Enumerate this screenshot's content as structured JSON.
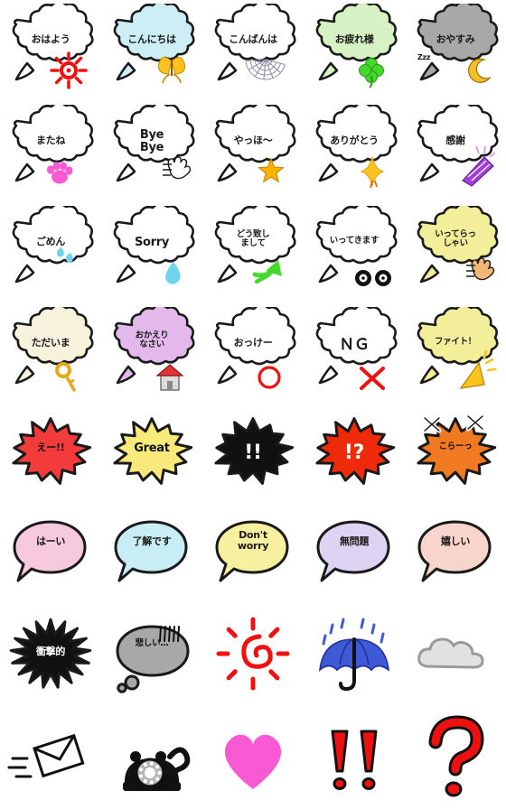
{
  "page": {
    "title": "Emoji sticker sheet",
    "background": "#ffffff",
    "columns": 5,
    "rows": 8
  },
  "palette": {
    "outline": "#1a1a1a",
    "white": "#ffffff",
    "lightblue": "#cdeef5",
    "lightgreen": "#d6f2c4",
    "gray": "#a8a8a8",
    "yellow": "#f2ee9a",
    "cream": "#f7f2dc",
    "lavender": "#e3b9ec",
    "pink": "#f7c9dc",
    "skyblue": "#c8edf5",
    "softyellow": "#f7f0a0",
    "softlavender": "#ded3f2",
    "peach": "#f7d5cc",
    "red": "#f43b3b",
    "orange": "#ef5a17",
    "black": "#111111",
    "brightred": "#ee1111",
    "hotpink": "#f95ad4",
    "gold": "#ffc21f",
    "green": "#45d92b",
    "blue": "#3f5ad6",
    "cloudgray": "#e2e2e2"
  },
  "stickers": [
    {
      "id": "ohayou",
      "row": 1,
      "col": 1,
      "text": "おはよう",
      "script": "jp",
      "shape": "cloud-bubble",
      "fill": "#ffffff",
      "decoration": "sun-icon",
      "decoration_color": "#f01010"
    },
    {
      "id": "konnichiwa",
      "row": 1,
      "col": 2,
      "text": "こんにちは",
      "script": "jp",
      "shape": "cloud-bubble",
      "fill": "#cdeef5",
      "decoration": "butterfly-icon",
      "decoration_color": "#ffc21f"
    },
    {
      "id": "konbanwa",
      "row": 1,
      "col": 3,
      "text": "こんばんは",
      "script": "jp",
      "shape": "cloud-bubble",
      "fill": "#ffffff",
      "decoration": "spiderweb-icon",
      "decoration_color": "#8f8fa8"
    },
    {
      "id": "otsukaresama",
      "row": 1,
      "col": 4,
      "text": "お疲れ様",
      "script": "jp",
      "shape": "cloud-bubble",
      "fill": "#d6f2c4",
      "decoration": "clover-icon",
      "decoration_color": "#45d92b"
    },
    {
      "id": "oyasumi",
      "row": 1,
      "col": 5,
      "text": "おやすみ",
      "script": "jp",
      "shape": "cloud-bubble",
      "fill": "#a8a8a8",
      "decoration": "moon-icon",
      "decoration_color": "#f5bd27",
      "sub_text": "Zzz"
    },
    {
      "id": "matane",
      "row": 2,
      "col": 1,
      "text": "またね",
      "script": "jp",
      "shape": "cloud-bubble",
      "fill": "#ffffff",
      "decoration": "pawprint-icon",
      "decoration_color": "#f95ad4"
    },
    {
      "id": "byebye",
      "row": 2,
      "col": 2,
      "text": "Bye\nBye",
      "script": "en",
      "shape": "cloud-bubble",
      "fill": "#ffffff",
      "decoration": "waving-hand-icon",
      "decoration_color": "#1a1a1a"
    },
    {
      "id": "yahho",
      "row": 2,
      "col": 3,
      "text": "やっほ〜",
      "script": "jp",
      "shape": "cloud-bubble",
      "fill": "#ffffff",
      "decoration": "star-icon",
      "decoration_color": "#ffb500"
    },
    {
      "id": "arigatou",
      "row": 2,
      "col": 4,
      "text": "ありがとう",
      "script": "jp",
      "shape": "cloud-bubble",
      "fill": "#ffffff",
      "decoration": "sparkle-icon",
      "decoration_color": "#ffc21f"
    },
    {
      "id": "kansha",
      "row": 2,
      "col": 5,
      "text": "感謝",
      "script": "jp",
      "shape": "cloud-bubble",
      "fill": "#ffffff",
      "decoration": "folding-fan-icon",
      "decoration_color": "#a23fd6"
    },
    {
      "id": "gomen",
      "row": 3,
      "col": 1,
      "text": "ごめん",
      "script": "jp",
      "shape": "cloud-bubble",
      "fill": "#ffffff",
      "decoration": "sweat-drops-icon",
      "decoration_color": "#6fd3ef"
    },
    {
      "id": "sorry",
      "row": 3,
      "col": 2,
      "text": "Sorry",
      "script": "en",
      "shape": "cloud-bubble",
      "fill": "#ffffff",
      "decoration": "teardrop-icon",
      "decoration_color": "#6fd3ef"
    },
    {
      "id": "douitashimashite",
      "row": 3,
      "col": 3,
      "text": "どう致し\nまして",
      "script": "jp-sm",
      "shape": "cloud-bubble",
      "fill": "#ffffff",
      "decoration": "arrow-icon",
      "decoration_color": "#45d92b"
    },
    {
      "id": "ittekimasu",
      "row": 3,
      "col": 4,
      "text": "いってきます",
      "script": "jp-sm",
      "shape": "cloud-bubble",
      "fill": "#ffffff",
      "decoration": "car-wheels-icon",
      "decoration_color": "#111111"
    },
    {
      "id": "itterasshai",
      "row": 3,
      "col": 5,
      "text": "いってらっ\nしゃい",
      "script": "jp-sm",
      "shape": "cloud-bubble",
      "fill": "#f2ee9a",
      "decoration": "waving-hand-icon",
      "decoration_color": "#f2b777"
    },
    {
      "id": "tadaima",
      "row": 4,
      "col": 1,
      "text": "ただいま",
      "script": "jp",
      "shape": "cloud-bubble",
      "fill": "#f7f2dc",
      "decoration": "key-icon",
      "decoration_color": "#e8a81c"
    },
    {
      "id": "okaerinasai",
      "row": 4,
      "col": 2,
      "text": "おかえり\nなさい",
      "script": "jp-sm",
      "shape": "cloud-bubble",
      "fill": "#e3b9ec",
      "decoration": "house-icon",
      "decoration_color": "#e03434"
    },
    {
      "id": "okke",
      "row": 4,
      "col": 3,
      "text": "おっけー",
      "script": "jp",
      "shape": "cloud-bubble",
      "fill": "#ffffff",
      "decoration": "circle-mark-icon",
      "decoration_color": "#ee1111"
    },
    {
      "id": "ng",
      "row": 4,
      "col": 4,
      "text": "ＮＧ",
      "script": "big",
      "shape": "cloud-bubble",
      "fill": "#ffffff",
      "decoration": "cross-mark-icon",
      "decoration_color": "#ee1111"
    },
    {
      "id": "fight",
      "row": 4,
      "col": 5,
      "text": "ファイト！",
      "script": "jp-sm",
      "shape": "cloud-bubble",
      "fill": "#f2ee9a",
      "decoration": "megaphone-icon",
      "decoration_color": "#ffc21f"
    },
    {
      "id": "ee",
      "row": 5,
      "col": 1,
      "text": "えー!!",
      "script": "jp",
      "shape": "burst",
      "fill": "#f43b3b",
      "text_color": "#111111",
      "decoration": "none",
      "decoration_color": ""
    },
    {
      "id": "great",
      "row": 5,
      "col": 2,
      "text": "Great",
      "script": "en",
      "shape": "burst",
      "fill": "#f7ea7a",
      "text_color": "#111111",
      "decoration": "none",
      "decoration_color": ""
    },
    {
      "id": "double-bang",
      "row": 5,
      "col": 3,
      "text": "!!",
      "script": "bang",
      "shape": "burst",
      "fill": "#111111",
      "text_color": "#ffffff",
      "decoration": "none",
      "decoration_color": ""
    },
    {
      "id": "interrobang",
      "row": 5,
      "col": 4,
      "text": "!?",
      "script": "bang",
      "shape": "burst",
      "fill": "#ef2a0a",
      "text_color": "#ffffff",
      "decoration": "none",
      "decoration_color": ""
    },
    {
      "id": "koraa",
      "row": 5,
      "col": 5,
      "text": "こらーっ",
      "script": "jp-sm",
      "shape": "burst",
      "fill": "#ef7a22",
      "text_color": "#111111",
      "decoration": "anger-mark-icon",
      "decoration_color": "#ffffff"
    },
    {
      "id": "haai",
      "row": 6,
      "col": 1,
      "text": "はーい",
      "script": "jp",
      "shape": "round-bubble",
      "fill": "#f7c9dc",
      "decoration": "none",
      "decoration_color": ""
    },
    {
      "id": "ryoukaidesu",
      "row": 6,
      "col": 2,
      "text": "了解です",
      "script": "jp",
      "shape": "round-bubble",
      "fill": "#c8edf5",
      "decoration": "none",
      "decoration_color": ""
    },
    {
      "id": "dont-worry",
      "row": 6,
      "col": 3,
      "text": "Don't\nworry",
      "script": "en-sm",
      "shape": "round-bubble",
      "fill": "#f7f0a0",
      "decoration": "none",
      "decoration_color": ""
    },
    {
      "id": "mumondai",
      "row": 6,
      "col": 4,
      "text": "無問題",
      "script": "jp",
      "shape": "round-bubble",
      "fill": "#ded3f2",
      "decoration": "none",
      "decoration_color": ""
    },
    {
      "id": "ureshii",
      "row": 6,
      "col": 5,
      "text": "嬉しい",
      "script": "jp",
      "shape": "round-bubble",
      "fill": "#f7d5cc",
      "decoration": "none",
      "decoration_color": ""
    },
    {
      "id": "shougekiteki",
      "row": 7,
      "col": 1,
      "text": "衝撃的",
      "script": "jp",
      "shape": "scribble-blob",
      "fill": "#111111",
      "text_color": "#ffffff",
      "decoration": "none",
      "decoration_color": ""
    },
    {
      "id": "kanashii",
      "row": 7,
      "col": 2,
      "text": "悲しい…",
      "script": "jp-sm",
      "shape": "thought-bubble",
      "fill": "#a8a8a8",
      "text_color": "#111111",
      "decoration": "gloom-lines-icon",
      "decoration_color": "#111111"
    },
    {
      "id": "sun",
      "row": 7,
      "col": 3,
      "text": "",
      "script": "jp",
      "shape": "icon-only",
      "fill": "",
      "decoration": "sun-spiral-icon",
      "decoration_color": "#f01010"
    },
    {
      "id": "umbrella",
      "row": 7,
      "col": 4,
      "text": "",
      "script": "jp",
      "shape": "icon-only",
      "fill": "",
      "decoration": "umbrella-rain-icon",
      "decoration_color": "#3f5ad6"
    },
    {
      "id": "cloud",
      "row": 7,
      "col": 5,
      "text": "",
      "script": "jp",
      "shape": "icon-only",
      "fill": "",
      "decoration": "cloud-icon",
      "decoration_color": "#e2e2e2"
    },
    {
      "id": "mail",
      "row": 8,
      "col": 1,
      "text": "",
      "script": "jp",
      "shape": "icon-only",
      "fill": "",
      "decoration": "flying-envelope-icon",
      "decoration_color": "#111111"
    },
    {
      "id": "telephone",
      "row": 8,
      "col": 2,
      "text": "",
      "script": "jp",
      "shape": "icon-only",
      "fill": "",
      "decoration": "rotary-phone-icon",
      "decoration_color": "#111111"
    },
    {
      "id": "heart",
      "row": 8,
      "col": 3,
      "text": "",
      "script": "jp",
      "shape": "icon-only",
      "fill": "",
      "decoration": "heart-icon",
      "decoration_color": "#f95ad4"
    },
    {
      "id": "double-exclamation",
      "row": 8,
      "col": 4,
      "text": "",
      "script": "jp",
      "shape": "icon-only",
      "fill": "",
      "decoration": "double-exclamation-icon",
      "decoration_color": "#ee1111"
    },
    {
      "id": "question",
      "row": 8,
      "col": 5,
      "text": "",
      "script": "jp",
      "shape": "icon-only",
      "fill": "",
      "decoration": "question-mark-icon",
      "decoration_color": "#ee1111"
    }
  ]
}
